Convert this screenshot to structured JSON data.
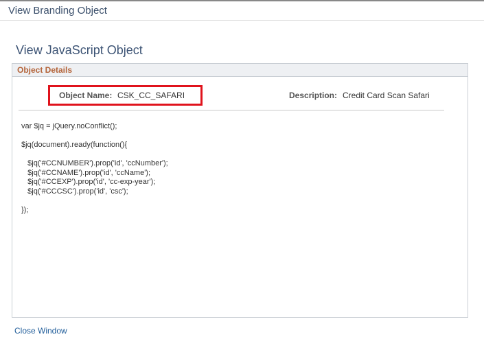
{
  "top_bar": {
    "title": "View Branding Object"
  },
  "page": {
    "title": "View JavaScript Object"
  },
  "details": {
    "section_label": "Object Details",
    "object_name_label": "Object Name:",
    "object_name_value": "CSK_CC_SAFARI",
    "description_label": "Description:",
    "description_value": "Credit Card Scan Safari",
    "highlight_color": "#e0131c",
    "code": "var $jq = jQuery.noConflict();\n\n$jq(document).ready(function(){\n\n   $jq('#CCNUMBER').prop('id', 'ccNumber');\n   $jq('#CCNAME').prop('id', 'ccName');\n   $jq('#CCEXP').prop('id', 'cc-exp-year');\n   $jq('#CCCSC').prop('id', 'csc');\n\n});"
  },
  "footer": {
    "close_label": "Close Window"
  }
}
